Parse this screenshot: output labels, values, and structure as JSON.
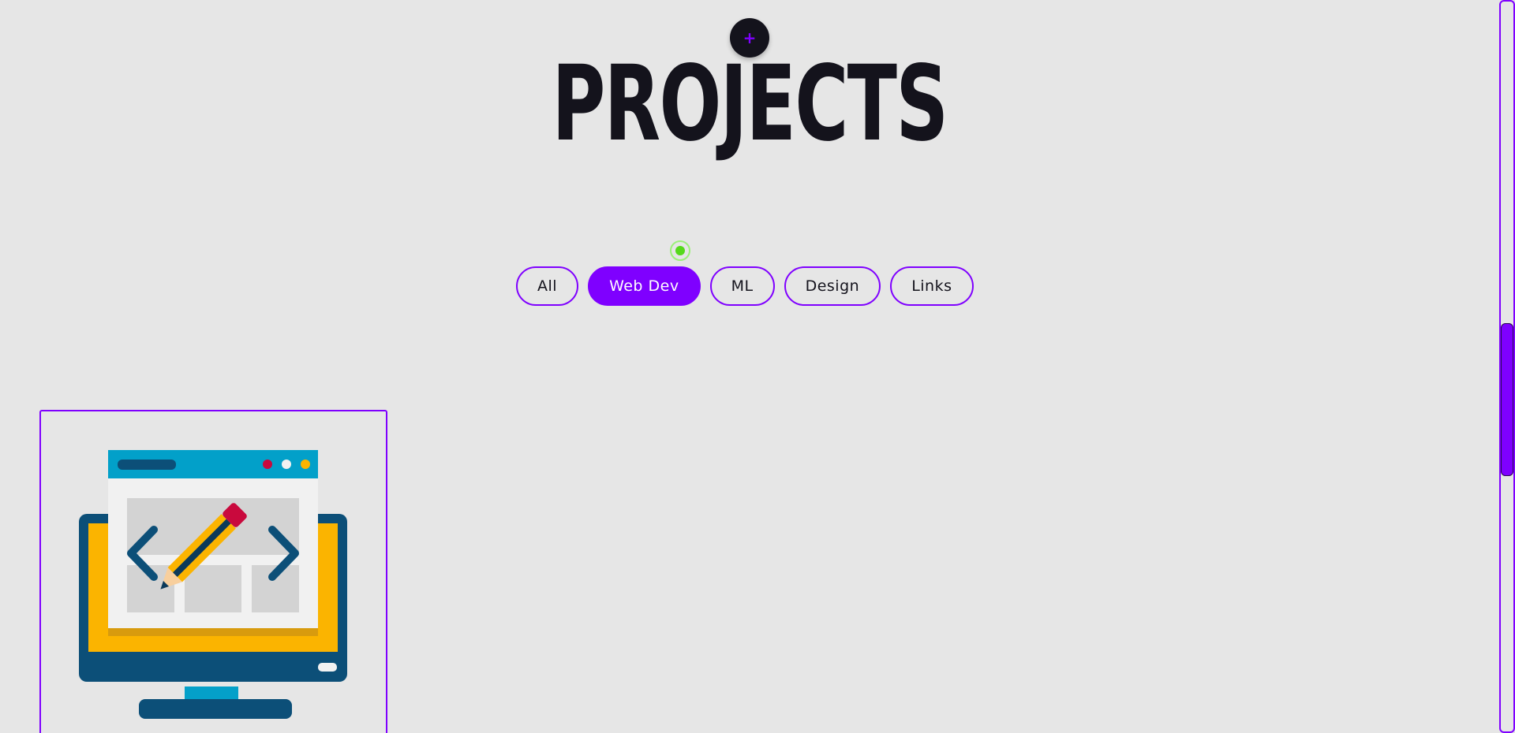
{
  "header": {
    "add_button": {
      "icon": "plus-icon",
      "label": "+"
    },
    "title": "PROJECTS"
  },
  "status_indicator": {
    "icon": "status-dot-icon",
    "color": "#55d91a"
  },
  "filters": [
    {
      "label": "All",
      "active": false
    },
    {
      "label": "Web Dev",
      "active": true
    },
    {
      "label": "ML",
      "active": false
    },
    {
      "label": "Design",
      "active": false
    },
    {
      "label": "Links",
      "active": false
    }
  ],
  "projects": [
    {
      "category": "Web Dev",
      "image_icon": "web-design-monitor-icon"
    }
  ],
  "colors": {
    "accent": "#7f00ff",
    "background": "#e6e6e6",
    "text": "#14131c"
  }
}
